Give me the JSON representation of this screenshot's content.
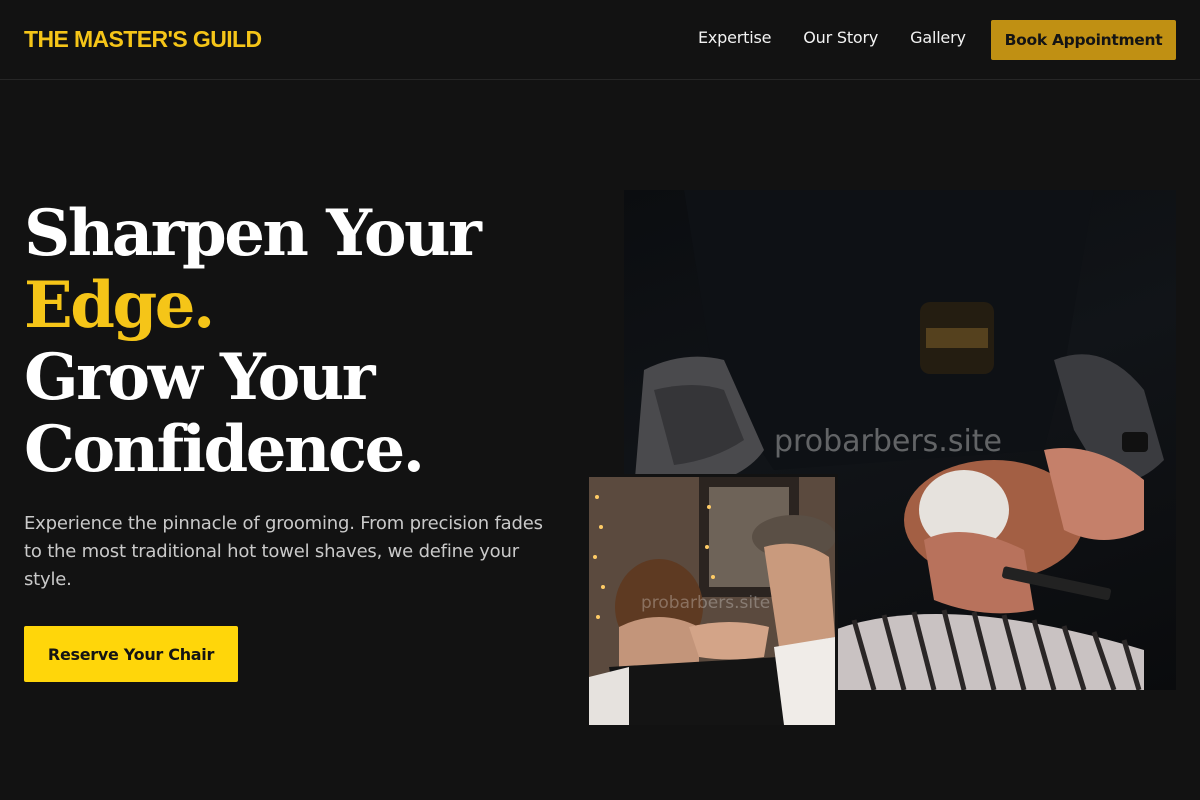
{
  "header": {
    "logo": "THE MASTER'S GUILD",
    "nav": [
      "Expertise",
      "Our Story",
      "Gallery"
    ],
    "cta": "Book Appointment"
  },
  "hero": {
    "title_line1": "Sharpen Your",
    "title_line2": "Edge.",
    "title_line3": "Grow Your",
    "title_line4": "Confidence.",
    "description": "Experience the pinnacle of grooming. From precision fades to the most traditional hot towel shaves, we define your style.",
    "cta": "Reserve Your Chair"
  },
  "images": {
    "main_watermark": "probarbers.site",
    "small_watermark": "probarbers.site"
  },
  "colors": {
    "background": "#121212",
    "accent": "#f5c518",
    "button_header": "#c09013",
    "button_hero": "#ffd60a"
  }
}
